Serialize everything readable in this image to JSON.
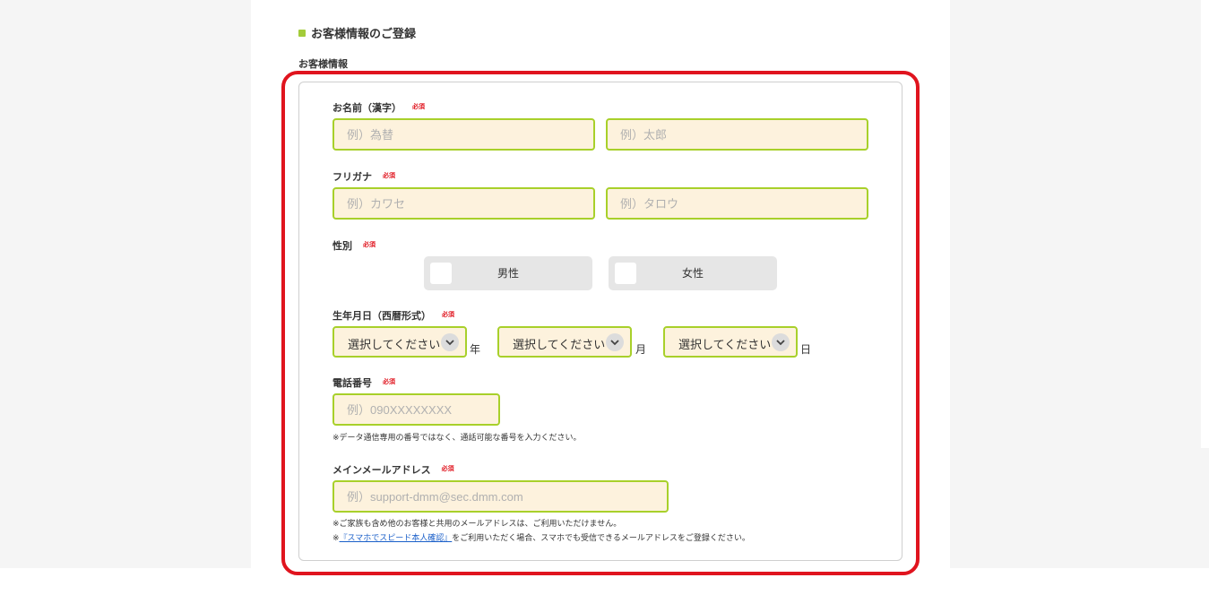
{
  "section": {
    "heading": "お客様情報のご登録",
    "subheading": "お客様情報"
  },
  "required_mark": "必須",
  "name_kanji": {
    "label": "お名前（漢字）",
    "last_placeholder": "例）為替",
    "first_placeholder": "例）太郎"
  },
  "name_kana": {
    "label": "フリガナ",
    "last_placeholder": "例）カワセ",
    "first_placeholder": "例）タロウ"
  },
  "gender": {
    "label": "性別",
    "options": [
      "男性",
      "女性"
    ]
  },
  "birthdate": {
    "label": "生年月日（西暦形式）",
    "year_value": "選択してください",
    "month_value": "選択してください",
    "day_value": "選択してください",
    "year_unit": "年",
    "month_unit": "月",
    "day_unit": "日"
  },
  "phone": {
    "label": "電話番号",
    "placeholder": "例）090XXXXXXXX",
    "note": "※データ通信専用の番号ではなく、通話可能な番号を入力ください。"
  },
  "email": {
    "label": "メインメールアドレス",
    "placeholder": "例）support-dmm@sec.dmm.com",
    "note1": "※ご家族も含め他のお客様と共用のメールアドレスは、ご利用いただけません。",
    "note2_prefix": "※",
    "note2_link": "『スマホでスピード本人確認』",
    "note2_suffix": "をご利用いただく場合、スマホでも受信できるメールアドレスをご登録ください。"
  },
  "colors": {
    "accent_green": "#a8d02a",
    "input_bg": "#fdf2dd",
    "required_red": "#e0141e",
    "highlight_red": "#e0141e"
  }
}
